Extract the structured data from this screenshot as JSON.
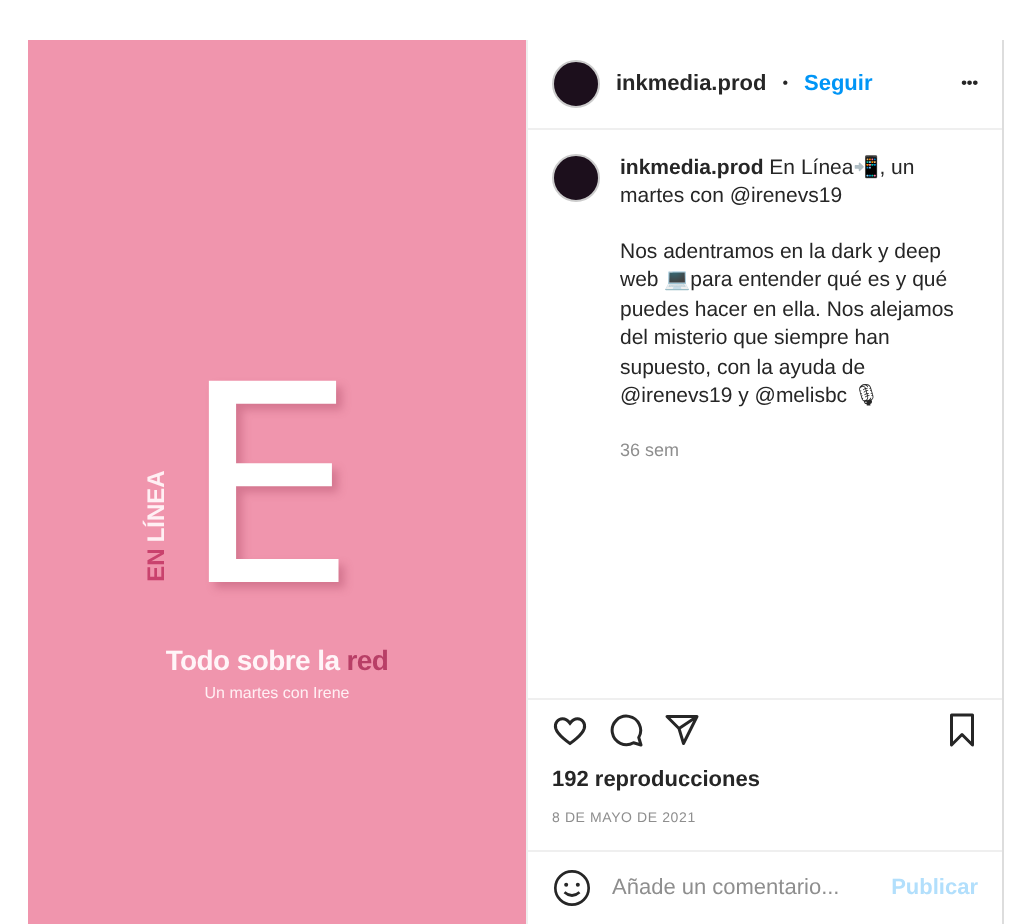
{
  "poster": {
    "vertical_label": [
      "EN",
      "LÍNEA"
    ],
    "letter": "E",
    "title": "Todo sobre la",
    "title_accent": "red",
    "subtitle": "Un martes con Irene"
  },
  "header": {
    "username": "inkmedia.prod",
    "separator": "•",
    "follow": "Seguir",
    "more": "•••"
  },
  "caption": {
    "paragraphs": [
      [
        {
          "kind": "user",
          "text": "inkmedia.prod"
        },
        {
          "kind": "text",
          "text": " En Línea📲, un martes con "
        },
        {
          "kind": "mention",
          "text": "@irenevs19"
        }
      ],
      [
        {
          "kind": "text",
          "text": "Nos adentramos en la dark y deep web 💻para entender qué es y qué puedes hacer en ella. Nos alejamos del misterio que siempre han supuesto, con la ayuda de "
        },
        {
          "kind": "mention",
          "text": "@irenevs19"
        },
        {
          "kind": "text",
          "text": " y "
        },
        {
          "kind": "mention",
          "text": "@melisbc"
        },
        {
          "kind": "text",
          "text": " 🎙"
        }
      ]
    ],
    "time": "36 sem"
  },
  "actions": {
    "liked": false,
    "saved": false
  },
  "views": "192 reproducciones",
  "date": "8 DE MAYO DE 2021",
  "comment": {
    "placeholder": "Añade un comentario...",
    "submit": "Publicar",
    "submit_disabled": true
  }
}
